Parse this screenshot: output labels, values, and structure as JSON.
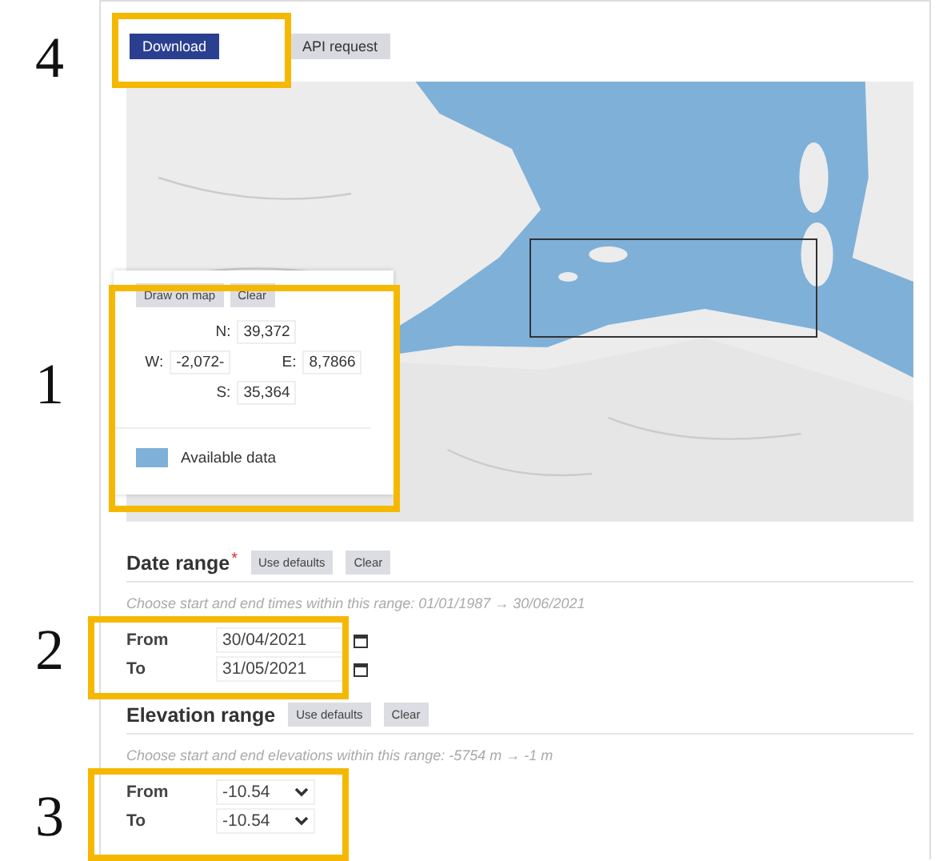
{
  "tabs": [
    {
      "label": "Download",
      "selected": true
    },
    {
      "label": "API request",
      "selected": false
    }
  ],
  "map": {
    "kind": "picture",
    "panel": {
      "buttons": [
        "Draw on map",
        "Clear"
      ],
      "north": {
        "label": "N:",
        "value": "39,372"
      },
      "west": {
        "label": "W:",
        "value": "-2,072-"
      },
      "east": {
        "label": "E:",
        "value": "8,7866"
      },
      "south": {
        "label": "S:",
        "value": "35,364"
      },
      "legend": "Available data"
    }
  },
  "sections": [
    {
      "title": "Date range",
      "required_mark": "*",
      "buttons": [
        "Use defaults",
        "Clear"
      ],
      "hint": "Choose start and end times within this range:",
      "range": "01/01/1987 → 30/06/2021",
      "fields": [
        {
          "kind": "date",
          "label": "From",
          "value": "30/04/2021"
        },
        {
          "kind": "date",
          "label": "To",
          "value": "31/05/2021"
        }
      ]
    },
    {
      "title": "Elevation range",
      "buttons": [
        "Use defaults",
        "Clear"
      ],
      "hint": "Choose start and end elevations within this range:",
      "range": "-5754 m → -1 m",
      "fields": [
        {
          "kind": "select",
          "label": "From",
          "value": "-10.54"
        },
        {
          "kind": "select",
          "label": "To",
          "value": "-10.54"
        }
      ]
    }
  ],
  "callouts": [
    {
      "number": "4"
    },
    {
      "number": "1"
    },
    {
      "number": "2"
    },
    {
      "number": "3"
    }
  ]
}
